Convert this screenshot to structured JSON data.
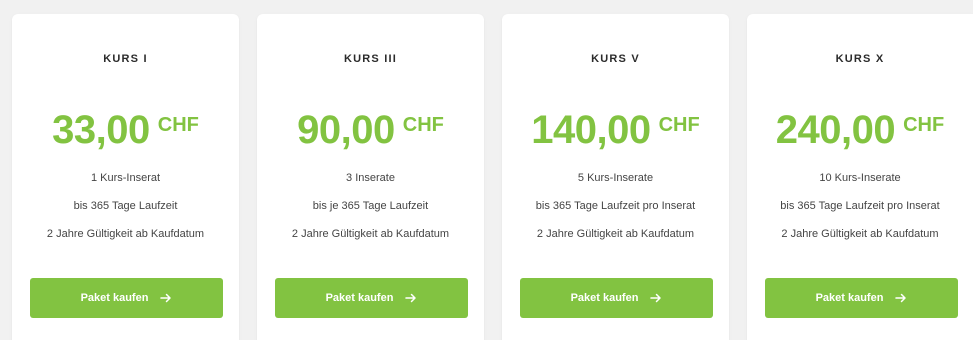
{
  "currency": "CHF",
  "button_label": "Paket kaufen",
  "accent_color": "#82c341",
  "plans": [
    {
      "title": "KURS I",
      "price": "33,00",
      "features": [
        "1 Kurs-Inserat",
        "bis 365 Tage Laufzeit",
        "2 Jahre Gültigkeit ab Kaufdatum"
      ]
    },
    {
      "title": "KURS III",
      "price": "90,00",
      "features": [
        "3 Inserate",
        "bis je 365 Tage Laufzeit",
        "2 Jahre Gültigkeit ab Kaufdatum"
      ]
    },
    {
      "title": "KURS V",
      "price": "140,00",
      "features": [
        "5 Kurs-Inserate",
        "bis 365 Tage Laufzeit pro Inserat",
        "2 Jahre Gültigkeit ab Kaufdatum"
      ]
    },
    {
      "title": "KURS X",
      "price": "240,00",
      "features": [
        "10 Kurs-Inserate",
        "bis 365 Tage Laufzeit pro Inserat",
        "2 Jahre Gültigkeit ab Kaufdatum"
      ]
    }
  ]
}
